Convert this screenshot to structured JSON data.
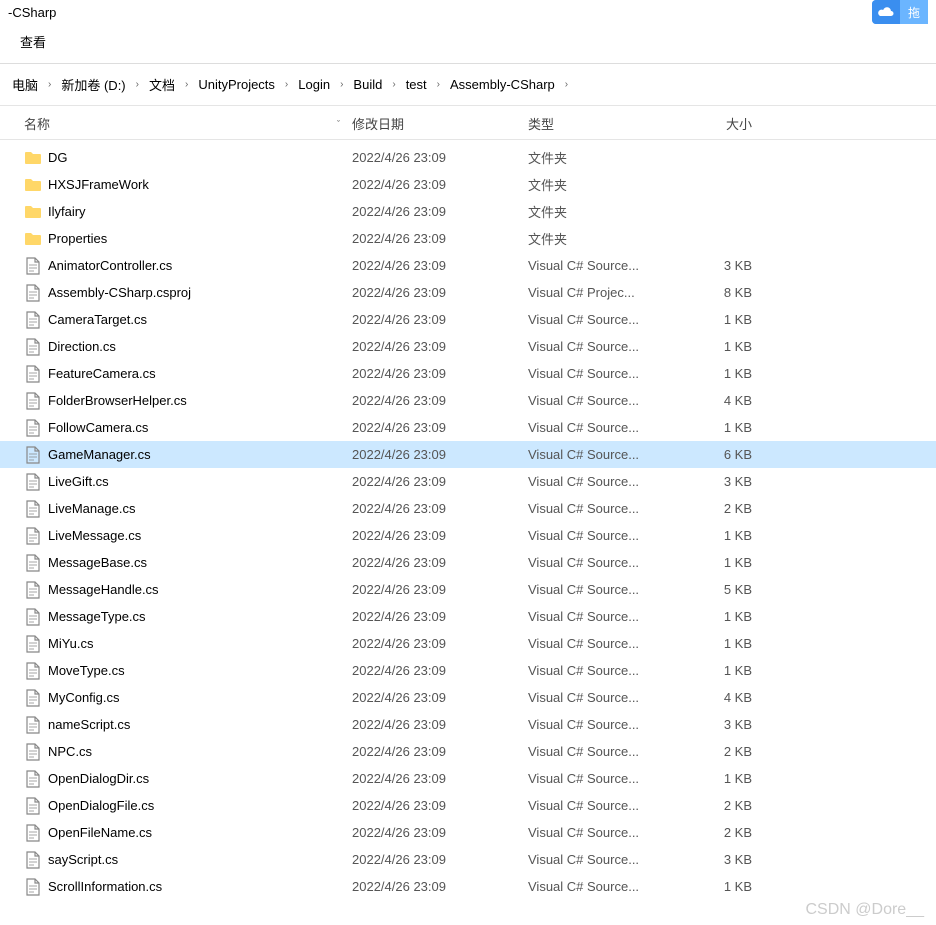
{
  "title_suffix": "-CSharp",
  "cloud_button": "拖",
  "ribbon": {
    "view_tab": "查看"
  },
  "breadcrumb": [
    "电脑",
    "新加卷 (D:)",
    "文档",
    "UnityProjects",
    "Login",
    "Build",
    "test",
    "Assembly-CSharp"
  ],
  "columns": {
    "name": "名称",
    "date": "修改日期",
    "type": "类型",
    "size": "大小"
  },
  "type_labels": {
    "folder": "文件夹",
    "cs": "Visual C# Source...",
    "csproj": "Visual C# Projec..."
  },
  "date_value": "2022/4/26 23:09",
  "files": [
    {
      "name": "DG",
      "kind": "folder",
      "size": ""
    },
    {
      "name": "HXSJFrameWork",
      "kind": "folder",
      "size": ""
    },
    {
      "name": "Ilyfairy",
      "kind": "folder",
      "size": ""
    },
    {
      "name": "Properties",
      "kind": "folder",
      "size": ""
    },
    {
      "name": "AnimatorController.cs",
      "kind": "cs",
      "size": "3 KB"
    },
    {
      "name": "Assembly-CSharp.csproj",
      "kind": "csproj",
      "size": "8 KB"
    },
    {
      "name": "CameraTarget.cs",
      "kind": "cs",
      "size": "1 KB"
    },
    {
      "name": "Direction.cs",
      "kind": "cs",
      "size": "1 KB"
    },
    {
      "name": "FeatureCamera.cs",
      "kind": "cs",
      "size": "1 KB"
    },
    {
      "name": "FolderBrowserHelper.cs",
      "kind": "cs",
      "size": "4 KB"
    },
    {
      "name": "FollowCamera.cs",
      "kind": "cs",
      "size": "1 KB"
    },
    {
      "name": "GameManager.cs",
      "kind": "cs",
      "size": "6 KB",
      "selected": true
    },
    {
      "name": "LiveGift.cs",
      "kind": "cs",
      "size": "3 KB"
    },
    {
      "name": "LiveManage.cs",
      "kind": "cs",
      "size": "2 KB"
    },
    {
      "name": "LiveMessage.cs",
      "kind": "cs",
      "size": "1 KB"
    },
    {
      "name": "MessageBase.cs",
      "kind": "cs",
      "size": "1 KB"
    },
    {
      "name": "MessageHandle.cs",
      "kind": "cs",
      "size": "5 KB"
    },
    {
      "name": "MessageType.cs",
      "kind": "cs",
      "size": "1 KB"
    },
    {
      "name": "MiYu.cs",
      "kind": "cs",
      "size": "1 KB"
    },
    {
      "name": "MoveType.cs",
      "kind": "cs",
      "size": "1 KB"
    },
    {
      "name": "MyConfig.cs",
      "kind": "cs",
      "size": "4 KB"
    },
    {
      "name": "nameScript.cs",
      "kind": "cs",
      "size": "3 KB"
    },
    {
      "name": "NPC.cs",
      "kind": "cs",
      "size": "2 KB"
    },
    {
      "name": "OpenDialogDir.cs",
      "kind": "cs",
      "size": "1 KB"
    },
    {
      "name": "OpenDialogFile.cs",
      "kind": "cs",
      "size": "2 KB"
    },
    {
      "name": "OpenFileName.cs",
      "kind": "cs",
      "size": "2 KB"
    },
    {
      "name": "sayScript.cs",
      "kind": "cs",
      "size": "3 KB"
    },
    {
      "name": "ScrollInformation.cs",
      "kind": "cs",
      "size": "1 KB"
    }
  ],
  "watermark": "CSDN @Dore__"
}
